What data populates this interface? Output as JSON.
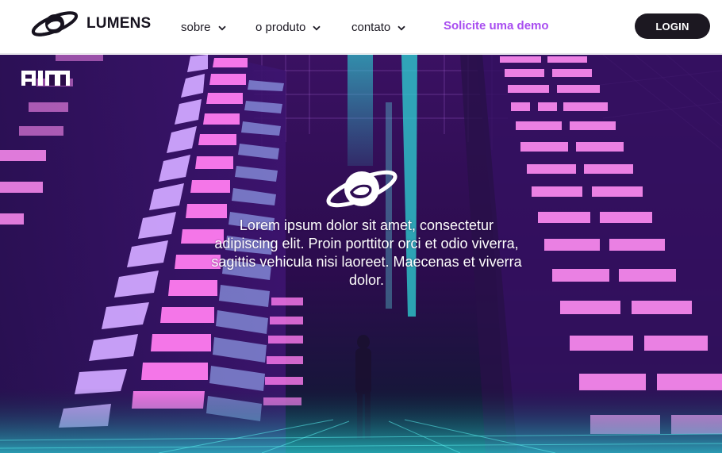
{
  "header": {
    "brand_name": "LUMENS",
    "brand_icon": "planet-icon",
    "nav": [
      {
        "label": "sobre",
        "icon": "chevron-down-icon"
      },
      {
        "label": "o produto",
        "icon": "chevron-down-icon"
      },
      {
        "label": "contato",
        "icon": "chevron-down-icon"
      }
    ],
    "demo_link": "Solicite uma demo",
    "login_label": "LOGIN"
  },
  "hero": {
    "watermark": "AIM",
    "logo_icon": "planet-icon",
    "body_text": "Lorem ipsum dolor sit amet, consectetur adipiscing elit. Proin porttitor orci et odio viverra, sagittis vehicula nisi laoreet. Maecenas et viverra dolor.",
    "background": "synthwave-city-image"
  },
  "colors": {
    "accent": "#a84df0",
    "login_bg": "#1c1821",
    "text_dark": "#1b1822",
    "hero_neon_pink": "#ff7cf0",
    "hero_neon_cyan": "#2fd6d6"
  }
}
